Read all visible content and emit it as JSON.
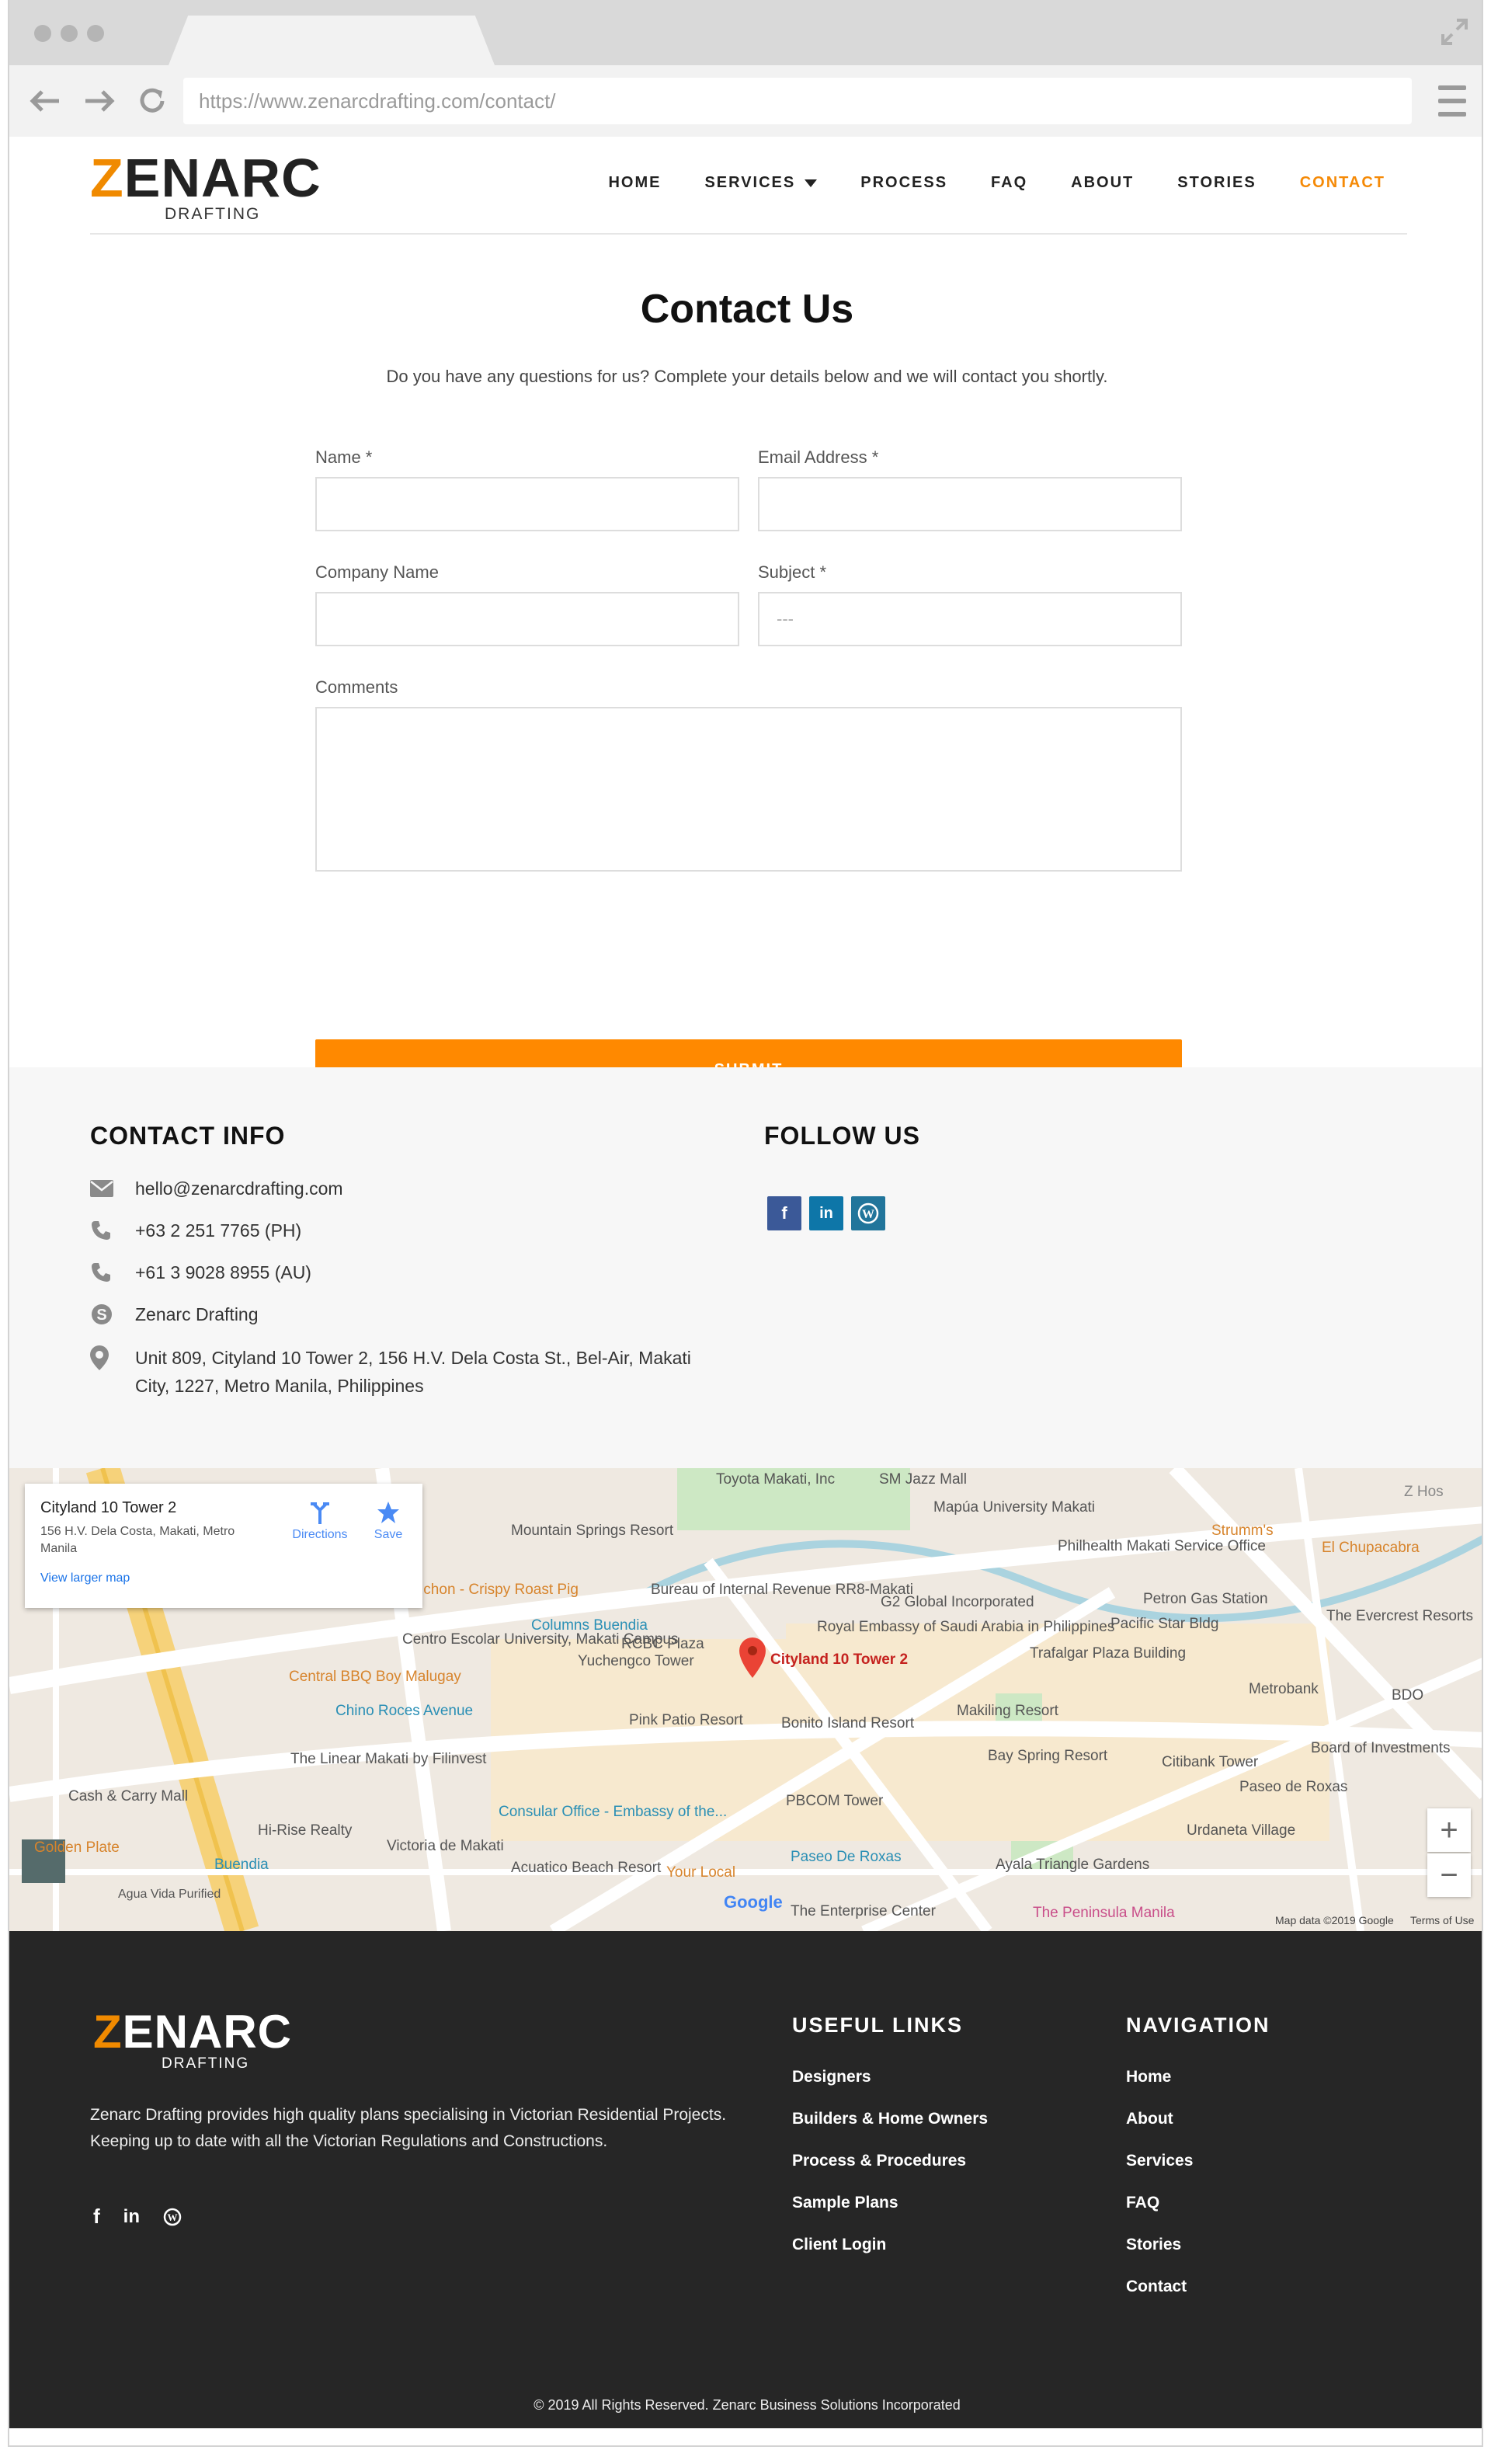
{
  "browser": {
    "url": "https://www.zenarcdrafting.com/contact/"
  },
  "brand": {
    "logo_main_first": "Z",
    "logo_main_rest": "ENARC",
    "logo_sub": "DRAFTING",
    "accent_color": "#f58a07",
    "footer_bg": "#262626"
  },
  "nav": {
    "items": [
      {
        "label": "HOME",
        "name": "nav-home"
      },
      {
        "label": "SERVICES",
        "name": "nav-services"
      },
      {
        "label": "PROCESS",
        "name": "nav-process"
      },
      {
        "label": "FAQ",
        "name": "nav-faq"
      },
      {
        "label": "ABOUT",
        "name": "nav-about"
      },
      {
        "label": "STORIES",
        "name": "nav-stories"
      },
      {
        "label": "CONTACT",
        "name": "nav-contact"
      }
    ]
  },
  "contact": {
    "title": "Contact Us",
    "subtitle": "Do you have any questions for us? Complete your details below and we will contact you shortly.",
    "name_label": "Name *",
    "email_label": "Email Address *",
    "company_label": "Company Name",
    "subject_label": "Subject *",
    "subject_value": "---",
    "comments_label": "Comments",
    "submit_label": "SUBMIT"
  },
  "info": {
    "title": "CONTACT INFO",
    "email": "hello@zenarcdrafting.com",
    "phone_ph": "+63 2 251 7765 (PH)",
    "phone_au": "+61 3 9028 8955 (AU)",
    "skype": "Zenarc Drafting",
    "address_line1": "Unit 809, Cityland 10 Tower 2, 156 H.V. Dela Costa St., Bel-Air, Makati",
    "address_line2": "City, 1227, Metro Manila, Philippines",
    "follow_title": "FOLLOW US",
    "social_colors": {
      "facebook": "#3b5998",
      "linkedin": "#0e76a8",
      "wordpress": "#21759b"
    }
  },
  "map": {
    "card_title": "Cityland 10 Tower 2",
    "card_address": "156 H.V. Dela Costa, Makati, Metro Manila",
    "directions": "Directions",
    "save": "Save",
    "larger_map": "View larger map",
    "pin_label": "Cityland 10 Tower 2",
    "labels": [
      "Toyota Makati, Inc",
      "SM Jazz Mall",
      "Mapúa University Makati",
      "Mountain Springs Resort",
      "Philhealth Makati Service Office",
      "Strumm's",
      "El Chupacabra",
      "Petron Gas Station",
      "Bureau of Internal Revenue RR8-Makati",
      "Zubuchon - Crispy Roast Pig",
      "Columns Buendia",
      "G2 Global Incorporated",
      "Royal Embassy of Saudi Arabia in Philippines",
      "Pacific Star Bldg",
      "The Evercrest Resorts",
      "Centro Escolar University, Makati Campus",
      "RCBC Plaza",
      "Yuchengco Tower",
      "Trafalgar Plaza Building",
      "Central BBQ Boy Malugay",
      "Makiling Resort",
      "Metrobank",
      "BDO",
      "Chino Roces Avenue",
      "Pink Patio Resort",
      "Bonito Island Resort",
      "Bay Spring Resort",
      "Citibank Tower",
      "Board of Investments",
      "The Linear Makati by Filinvest",
      "PBCOM Tower",
      "Paseo de Roxas",
      "Cash & Carry Mall",
      "Consular Office - Embassy of the...",
      "Hi-Rise Realty",
      "Victoria de Makati",
      "Urdaneta Village",
      "Golden Plate",
      "Buendia",
      "Acuatico Beach Resort",
      "Your Local",
      "Paseo De Roxas",
      "Ayala Triangle Gardens",
      "The Enterprise Center",
      "The Peninsula Manila",
      "Agua Vida Purified",
      "Z Hos"
    ],
    "attribution": "Map data ©2019 Google",
    "terms": "Terms of Use",
    "google": "Google",
    "zoom_in": "+",
    "zoom_out": "−"
  },
  "footer": {
    "about": "Zenarc Drafting provides high quality plans specialising in Victorian Residential Projects. Keeping up to date with all the Victorian Regulations and Constructions.",
    "useful_title": "USEFUL LINKS",
    "useful_links": [
      "Designers",
      "Builders & Home Owners",
      "Process & Procedures",
      "Sample Plans",
      "Client Login"
    ],
    "nav_title": "NAVIGATION",
    "nav_links": [
      "Home",
      "About",
      "Services",
      "FAQ",
      "Stories",
      "Contact"
    ],
    "copyright": "© 2019 All Rights Reserved. Zenarc Business Solutions Incorporated"
  }
}
